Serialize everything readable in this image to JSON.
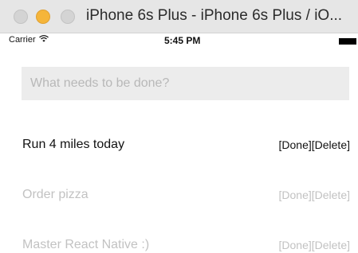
{
  "window": {
    "title": "iPhone 6s Plus - iPhone 6s Plus / iO..."
  },
  "status_bar": {
    "carrier": "Carrier",
    "time": "5:45 PM"
  },
  "input": {
    "placeholder": "What needs to be done?",
    "value": ""
  },
  "todos": [
    {
      "text": "Run 4 miles today",
      "done_label": "[Done]",
      "delete_label": "[Delete]",
      "completed": false
    },
    {
      "text": "Order pizza",
      "done_label": "[Done]",
      "delete_label": "[Delete]",
      "completed": true
    },
    {
      "text": "Master React Native :)",
      "done_label": "[Done]",
      "delete_label": "[Delete]",
      "completed": true
    }
  ],
  "colors": {
    "active_text": "#111111",
    "completed_text": "#c2c2c2",
    "input_background": "#ececec",
    "minimize_button": "#f5b53a"
  }
}
